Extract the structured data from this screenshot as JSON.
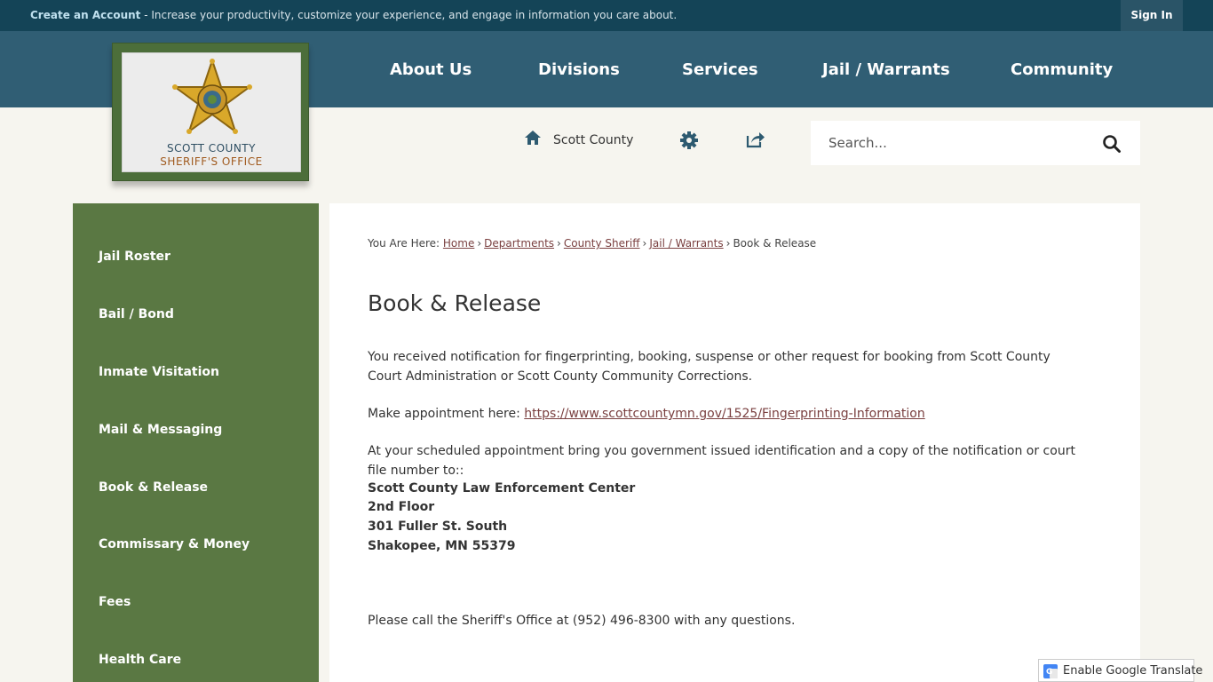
{
  "topbar": {
    "create_account": "Create an Account",
    "message": " - Increase your productivity, customize your experience, and engage in information you care about.",
    "sign_in": "Sign In"
  },
  "logo": {
    "line1": "SCOTT COUNTY",
    "line2": "SHERIFF'S OFFICE"
  },
  "nav": {
    "items": [
      "About Us",
      "Divisions",
      "Services",
      "Jail / Warrants",
      "Community"
    ]
  },
  "utility": {
    "home_label": "Scott County"
  },
  "search": {
    "placeholder": "Search..."
  },
  "sidebar": {
    "items": [
      "Jail Roster",
      "Bail / Bond",
      "Inmate Visitation",
      "Mail & Messaging",
      "Book & Release",
      "Commissary & Money",
      "Fees",
      "Health Care"
    ]
  },
  "breadcrumb": {
    "prefix": "You Are Here:",
    "links": [
      "Home",
      "Departments",
      "County Sheriff",
      "Jail / Warrants"
    ],
    "current": "Book & Release"
  },
  "content": {
    "title": "Book & Release",
    "para1": "You received notification for fingerprinting, booking, suspense or other request for booking from Scott County Court Administration or Scott County Community Corrections.",
    "para2_prefix": "Make appointment here: ",
    "para2_link": "https://www.scottcountymn.gov/1525/Fingerprinting-Information",
    "para3": "At your scheduled appointment bring you government issued identification and a copy of the notification or court file number to::",
    "address": [
      "Scott County Law Enforcement Center",
      "2nd Floor",
      "301 Fuller St. South",
      "Shakopee, MN  55379"
    ],
    "para4": "Please call the Sheriff's Office at (952) 496-8300 with any questions."
  },
  "translate": {
    "label": "Enable Google Translate"
  },
  "colors": {
    "topbar": "#144457",
    "nav": "#305e74",
    "sidebar": "#5a7843",
    "link": "#7a4040"
  }
}
